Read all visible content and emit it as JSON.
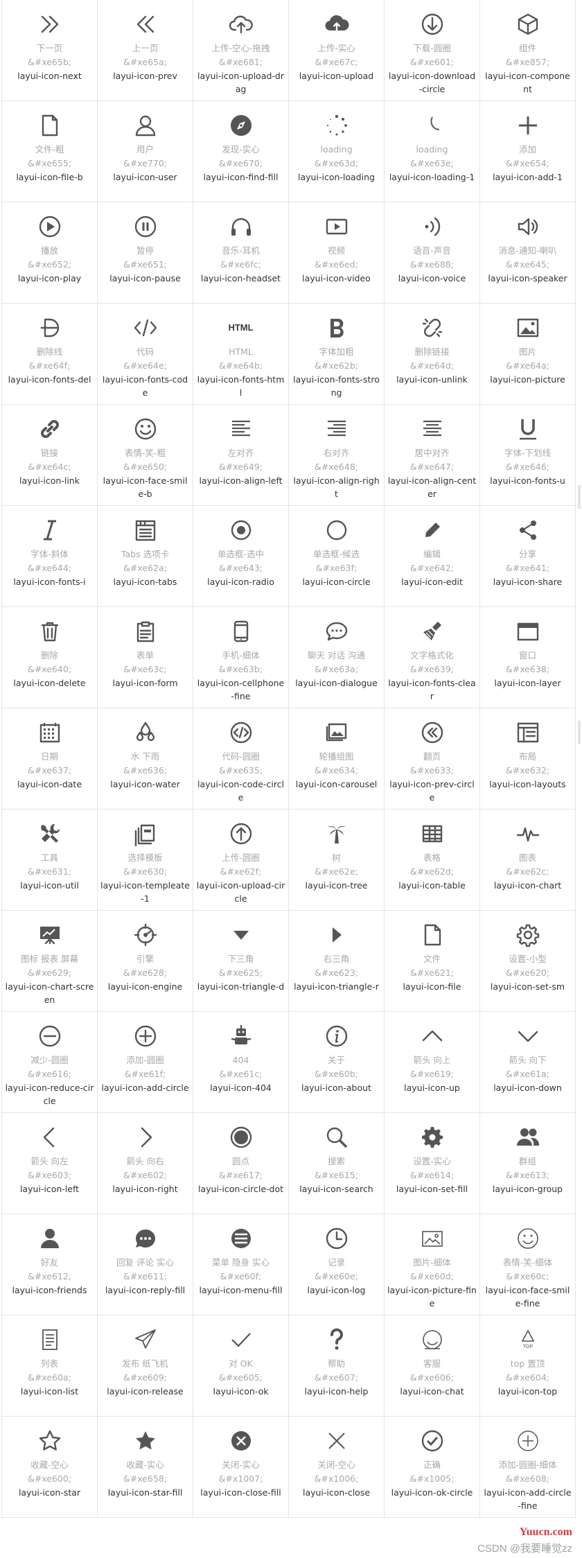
{
  "icons": [
    {
      "cn": "下一页",
      "code": "&#xe65b;",
      "cls": "layui-icon-next",
      "glyph": "chevrons-right"
    },
    {
      "cn": "上一页",
      "code": "&#xe65a;",
      "cls": "layui-icon-prev",
      "glyph": "chevrons-left"
    },
    {
      "cn": "上传-空心-拖拽",
      "code": "&#xe681;",
      "cls": "layui-icon-upload-drag",
      "glyph": "cloud-upload-outline"
    },
    {
      "cn": "上传-实心",
      "code": "&#xe67c;",
      "cls": "layui-icon-upload",
      "glyph": "cloud-upload-solid"
    },
    {
      "cn": "下载-圆圈",
      "code": "&#xe601;",
      "cls": "layui-icon-download-circle",
      "glyph": "download-circle"
    },
    {
      "cn": "组件",
      "code": "&#xe857;",
      "cls": "layui-icon-component",
      "glyph": "cube"
    },
    {
      "cn": "文件-粗",
      "code": "&#xe655;",
      "cls": "layui-icon-file-b",
      "glyph": "file-b"
    },
    {
      "cn": "用户",
      "code": "&#xe770;",
      "cls": "layui-icon-user",
      "glyph": "user"
    },
    {
      "cn": "发现-实心",
      "code": "&#xe670;",
      "cls": "layui-icon-find-fill",
      "glyph": "compass"
    },
    {
      "cn": "loading",
      "code": "&#xe63d;",
      "cls": "layui-icon-loading",
      "glyph": "loading-dots"
    },
    {
      "cn": "loading",
      "code": "&#xe63e;",
      "cls": "layui-icon-loading-1",
      "glyph": "loading-arc"
    },
    {
      "cn": "添加",
      "code": "&#xe654;",
      "cls": "layui-icon-add-1",
      "glyph": "plus"
    },
    {
      "cn": "播放",
      "code": "&#xe652;",
      "cls": "layui-icon-play",
      "glyph": "play-circle"
    },
    {
      "cn": "暂停",
      "code": "&#xe651;",
      "cls": "layui-icon-pause",
      "glyph": "pause-circle"
    },
    {
      "cn": "音乐-耳机",
      "code": "&#xe6fc;",
      "cls": "layui-icon-headset",
      "glyph": "headset"
    },
    {
      "cn": "视频",
      "code": "&#xe6ed;",
      "cls": "layui-icon-video",
      "glyph": "video"
    },
    {
      "cn": "语音-声音",
      "code": "&#xe688;",
      "cls": "layui-icon-voice",
      "glyph": "voice"
    },
    {
      "cn": "消息-通知-喇叭",
      "code": "&#xe645;",
      "cls": "layui-icon-speaker",
      "glyph": "speaker"
    },
    {
      "cn": "删除线",
      "code": "&#xe64f;",
      "cls": "layui-icon-fonts-del",
      "glyph": "strike-d"
    },
    {
      "cn": "代码",
      "code": "&#xe64e;",
      "cls": "layui-icon-fonts-code",
      "glyph": "code"
    },
    {
      "cn": "HTML",
      "code": "&#xe64b;",
      "cls": "layui-icon-fonts-html",
      "glyph": "html-text",
      "glyph_text": "HTML"
    },
    {
      "cn": "字体加粗",
      "code": "&#xe62b;",
      "cls": "layui-icon-fonts-strong",
      "glyph": "bold-b"
    },
    {
      "cn": "删除链接",
      "code": "&#xe64d;",
      "cls": "layui-icon-unlink",
      "glyph": "unlink"
    },
    {
      "cn": "图片",
      "code": "&#xe64a;",
      "cls": "layui-icon-picture",
      "glyph": "picture"
    },
    {
      "cn": "链接",
      "code": "&#xe64c;",
      "cls": "layui-icon-link",
      "glyph": "link"
    },
    {
      "cn": "表情-笑-粗",
      "code": "&#xe650;",
      "cls": "layui-icon-face-smile-b",
      "glyph": "smile"
    },
    {
      "cn": "左对齐",
      "code": "&#xe649;",
      "cls": "layui-icon-align-left",
      "glyph": "align-left"
    },
    {
      "cn": "右对齐",
      "code": "&#xe648;",
      "cls": "layui-icon-align-right",
      "glyph": "align-right"
    },
    {
      "cn": "居中对齐",
      "code": "&#xe647;",
      "cls": "layui-icon-align-center",
      "glyph": "align-center"
    },
    {
      "cn": "字体-下划线",
      "code": "&#xe646;",
      "cls": "layui-icon-fonts-u",
      "glyph": "underline-u"
    },
    {
      "cn": "字体-斜体",
      "code": "&#xe644;",
      "cls": "layui-icon-fonts-i",
      "glyph": "italic-i"
    },
    {
      "cn": "Tabs 选项卡",
      "code": "&#xe62a;",
      "cls": "layui-icon-tabs",
      "glyph": "tabs"
    },
    {
      "cn": "单选框-选中",
      "code": "&#xe643;",
      "cls": "layui-icon-radio",
      "glyph": "radio"
    },
    {
      "cn": "单选框-候选",
      "code": "&#xe63f;",
      "cls": "layui-icon-circle",
      "glyph": "circle"
    },
    {
      "cn": "编辑",
      "code": "&#xe642;",
      "cls": "layui-icon-edit",
      "glyph": "pencil"
    },
    {
      "cn": "分享",
      "code": "&#xe641;",
      "cls": "layui-icon-share",
      "glyph": "share"
    },
    {
      "cn": "删除",
      "code": "&#xe640;",
      "cls": "layui-icon-delete",
      "glyph": "trash"
    },
    {
      "cn": "表单",
      "code": "&#xe63c;",
      "cls": "layui-icon-form",
      "glyph": "clipboard"
    },
    {
      "cn": "手机-细体",
      "code": "&#xe63b;",
      "cls": "layui-icon-cellphone-fine",
      "glyph": "cellphone"
    },
    {
      "cn": "聊天 对话 沟通",
      "code": "&#xe63a;",
      "cls": "layui-icon-dialogue",
      "glyph": "dialogue"
    },
    {
      "cn": "文字格式化",
      "code": "&#xe639;",
      "cls": "layui-icon-fonts-clear",
      "glyph": "brush"
    },
    {
      "cn": "窗口",
      "code": "&#xe638;",
      "cls": "layui-icon-layer",
      "glyph": "window"
    },
    {
      "cn": "日期",
      "code": "&#xe637;",
      "cls": "layui-icon-date",
      "glyph": "calendar"
    },
    {
      "cn": "水 下雨",
      "code": "&#xe636;",
      "cls": "layui-icon-water",
      "glyph": "drops"
    },
    {
      "cn": "代码-圆圈",
      "code": "&#xe635;",
      "cls": "layui-icon-code-circle",
      "glyph": "code-circle"
    },
    {
      "cn": "轮播组图",
      "code": "&#xe634;",
      "cls": "layui-icon-carousel",
      "glyph": "carousel"
    },
    {
      "cn": "翻页",
      "code": "&#xe633;",
      "cls": "layui-icon-prev-circle",
      "glyph": "prev-circle"
    },
    {
      "cn": "布局",
      "code": "&#xe632;",
      "cls": "layui-icon-layouts",
      "glyph": "layouts"
    },
    {
      "cn": "工具",
      "code": "&#xe631;",
      "cls": "layui-icon-util",
      "glyph": "tools"
    },
    {
      "cn": "选择模板",
      "code": "&#xe630;",
      "cls": "layui-icon-templeate-1",
      "glyph": "template"
    },
    {
      "cn": "上传-圆圈",
      "code": "&#xe62f;",
      "cls": "layui-icon-upload-circle",
      "glyph": "upload-circle"
    },
    {
      "cn": "树",
      "code": "&#xe62e;",
      "cls": "layui-icon-tree",
      "glyph": "palm-tree"
    },
    {
      "cn": "表格",
      "code": "&#xe62d;",
      "cls": "layui-icon-table",
      "glyph": "table"
    },
    {
      "cn": "图表",
      "code": "&#xe62c;",
      "cls": "layui-icon-chart",
      "glyph": "pulse"
    },
    {
      "cn": "图标 报表 屏幕",
      "code": "&#xe629;",
      "cls": "layui-icon-chart-screen",
      "glyph": "chart-screen"
    },
    {
      "cn": "引擎",
      "code": "&#xe628;",
      "cls": "layui-icon-engine",
      "glyph": "engine"
    },
    {
      "cn": "下三角",
      "code": "&#xe625;",
      "cls": "layui-icon-triangle-d",
      "glyph": "triangle-down"
    },
    {
      "cn": "右三角",
      "code": "&#xe623;",
      "cls": "layui-icon-triangle-r",
      "glyph": "triangle-right"
    },
    {
      "cn": "文件",
      "code": "&#xe621;",
      "cls": "layui-icon-file",
      "glyph": "file"
    },
    {
      "cn": "设置-小型",
      "code": "&#xe620;",
      "cls": "layui-icon-set-sm",
      "glyph": "gear-outline"
    },
    {
      "cn": "减少-圆圈",
      "code": "&#xe616;",
      "cls": "layui-icon-reduce-circle",
      "glyph": "minus-circle"
    },
    {
      "cn": "添加-圆圈",
      "code": "&#xe61f;",
      "cls": "layui-icon-add-circle",
      "glyph": "plus-circle"
    },
    {
      "cn": "404",
      "code": "&#xe61c;",
      "cls": "layui-icon-404",
      "glyph": "robot-404"
    },
    {
      "cn": "关于",
      "code": "&#xe60b;",
      "cls": "layui-icon-about",
      "glyph": "info-circle"
    },
    {
      "cn": "箭头 向上",
      "code": "&#xe619;",
      "cls": "layui-icon-up",
      "glyph": "chevron-up"
    },
    {
      "cn": "箭头 向下",
      "code": "&#xe61a;",
      "cls": "layui-icon-down",
      "glyph": "chevron-down"
    },
    {
      "cn": "箭头 向左",
      "code": "&#xe603;",
      "cls": "layui-icon-left",
      "glyph": "chevron-left"
    },
    {
      "cn": "箭头 向右",
      "code": "&#xe602;",
      "cls": "layui-icon-right",
      "glyph": "chevron-right"
    },
    {
      "cn": "圆点",
      "code": "&#xe617;",
      "cls": "layui-icon-circle-dot",
      "glyph": "circle-dot"
    },
    {
      "cn": "搜索",
      "code": "&#xe615;",
      "cls": "layui-icon-search",
      "glyph": "search"
    },
    {
      "cn": "设置-实心",
      "code": "&#xe614;",
      "cls": "layui-icon-set-fill",
      "glyph": "gear-fill"
    },
    {
      "cn": "群组",
      "code": "&#xe613;",
      "cls": "layui-icon-group",
      "glyph": "group"
    },
    {
      "cn": "好友",
      "code": "&#xe612;",
      "cls": "layui-icon-friends",
      "glyph": "friend"
    },
    {
      "cn": "回复 评论 实心",
      "code": "&#xe611;",
      "cls": "layui-icon-reply-fill",
      "glyph": "reply-fill"
    },
    {
      "cn": "菜单 隐身 实心",
      "code": "&#xe60f;",
      "cls": "layui-icon-menu-fill",
      "glyph": "menu-fill"
    },
    {
      "cn": "记录",
      "code": "&#xe60e;",
      "cls": "layui-icon-log",
      "glyph": "clock"
    },
    {
      "cn": "图片-细体",
      "code": "&#xe60d;",
      "cls": "layui-icon-picture-fine",
      "glyph": "picture-fine"
    },
    {
      "cn": "表情-笑-细体",
      "code": "&#xe60c;",
      "cls": "layui-icon-face-smile-fine",
      "glyph": "smile-fine"
    },
    {
      "cn": "列表",
      "code": "&#xe60a;",
      "cls": "layui-icon-list",
      "glyph": "list-doc"
    },
    {
      "cn": "发布 纸飞机",
      "code": "&#xe609;",
      "cls": "layui-icon-release",
      "glyph": "paper-plane"
    },
    {
      "cn": "对 OK",
      "code": "&#xe605;",
      "cls": "layui-icon-ok",
      "glyph": "check"
    },
    {
      "cn": "帮助",
      "code": "&#xe607;",
      "cls": "layui-icon-help",
      "glyph": "question"
    },
    {
      "cn": "客服",
      "code": "&#xe606;",
      "cls": "layui-icon-chat",
      "glyph": "chat-face"
    },
    {
      "cn": "top 置顶",
      "code": "&#xe604;",
      "cls": "layui-icon-top",
      "glyph": "top",
      "glyph_text": "TOP"
    },
    {
      "cn": "收藏-空心",
      "code": "&#xe600;",
      "cls": "layui-icon-star",
      "glyph": "star-outline"
    },
    {
      "cn": "收藏-实心",
      "code": "&#xe658;",
      "cls": "layui-icon-star-fill",
      "glyph": "star-fill"
    },
    {
      "cn": "关闭-实心",
      "code": "&#x1007;",
      "cls": "layui-icon-close-fill",
      "glyph": "close-fill"
    },
    {
      "cn": "关闭-空心",
      "code": "&#x1006;",
      "cls": "layui-icon-close",
      "glyph": "close"
    },
    {
      "cn": "正确",
      "code": "&#x1005;",
      "cls": "layui-icon-ok-circle",
      "glyph": "ok-circle"
    },
    {
      "cn": "添加-圆圈-细体",
      "code": "&#xe608;",
      "cls": "layui-icon-add-circle-fine",
      "glyph": "add-circle-fine"
    }
  ],
  "watermark": "CSDN @我要睡觉zz",
  "site_mark": "Yuucn.com",
  "colors": {
    "icon": "#555555",
    "label_gray": "#a8a8a8",
    "class_text": "#333333",
    "border": "#e4e4e4"
  }
}
